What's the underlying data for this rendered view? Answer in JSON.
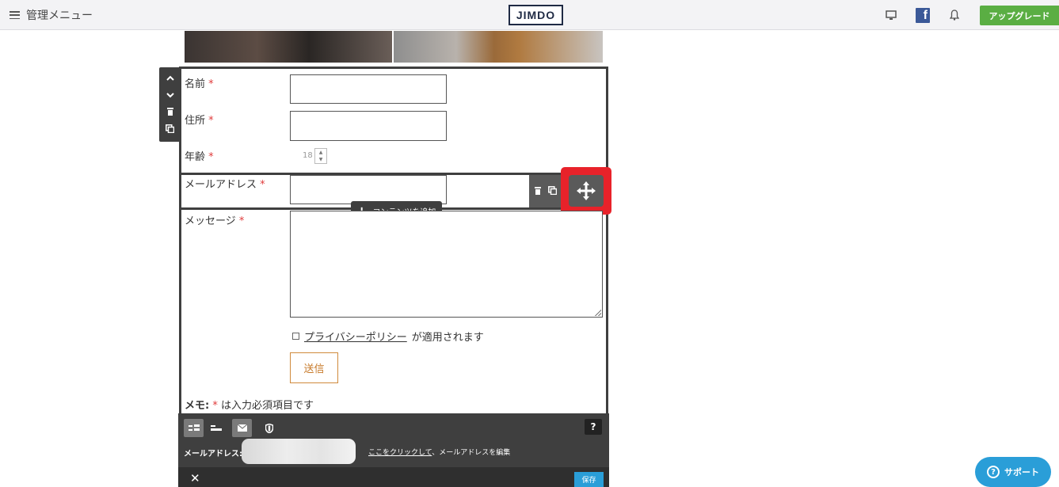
{
  "header": {
    "menu_label": "管理メニュー",
    "logo_text": "JIMDO",
    "facebook_glyph": "f",
    "upgrade_label": "アップグレード"
  },
  "form": {
    "fields": [
      {
        "label": "名前",
        "required_mark": "*"
      },
      {
        "label": "住所",
        "required_mark": "*"
      },
      {
        "label": "年齢",
        "required_mark": "*",
        "value": "18"
      },
      {
        "label": "メールアドレス",
        "required_mark": "*"
      },
      {
        "label": "メッセージ",
        "required_mark": "*"
      }
    ],
    "add_content_label": "コンテンツを追加",
    "privacy_link": "プライバシーポリシー",
    "privacy_suffix": "が適用されます",
    "submit_label": "送信",
    "memo_prefix": "メモ:",
    "memo_required_mark": "*",
    "memo_text": "は入力必須項目です"
  },
  "panel": {
    "help_label": "?",
    "email_label": "メールアドレス:",
    "edit_link": "ここをクリックして",
    "edit_suffix": "、メールアドレスを編集",
    "close_label": "✕",
    "save_label": "保存"
  },
  "support": {
    "label": "サポート",
    "icon_glyph": "?"
  },
  "colors": {
    "upgrade": "#5aae43",
    "required": "#e03b3b",
    "highlight": "#e8222a",
    "save": "#2a9ed8",
    "support": "#2a9ed8",
    "submit_border": "#d08a3c"
  }
}
